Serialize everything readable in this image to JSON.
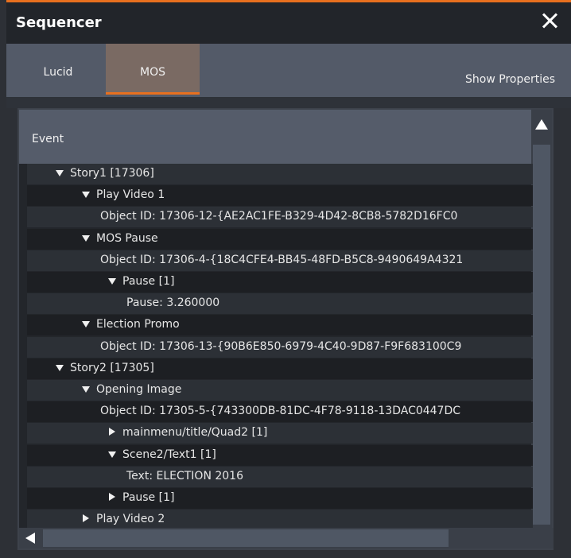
{
  "window": {
    "title": "Sequencer"
  },
  "tabs": [
    {
      "label": "Lucid",
      "active": false
    },
    {
      "label": "MOS",
      "active": true
    }
  ],
  "show_properties_label": "Show Properties",
  "column_header": "Event",
  "tree": [
    {
      "text": "Story1 [17306]",
      "expander": "down",
      "level": 0
    },
    {
      "text": "Play Video 1",
      "expander": "down",
      "level": 1
    },
    {
      "text": "Object ID: 17306-12-{AE2AC1FE-B329-4D42-8CB8-5782D16FC0",
      "expander": "none",
      "level": 2
    },
    {
      "text": "MOS Pause",
      "expander": "down",
      "level": 1
    },
    {
      "text": "Object ID: 17306-4-{18C4CFE4-BB45-48FD-B5C8-9490649A4321",
      "expander": "none",
      "level": 2
    },
    {
      "text": "Pause [1]",
      "expander": "down",
      "level": 2
    },
    {
      "text": "Pause: 3.260000",
      "expander": "none",
      "level": 3
    },
    {
      "text": "Election Promo",
      "expander": "down",
      "level": 1
    },
    {
      "text": "Object ID: 17306-13-{90B6E850-6979-4C40-9D87-F9F683100C9",
      "expander": "none",
      "level": 2
    },
    {
      "text": "Story2 [17305]",
      "expander": "down",
      "level": 0
    },
    {
      "text": "Opening Image",
      "expander": "down",
      "level": 1
    },
    {
      "text": "Object ID: 17305-5-{743300DB-81DC-4F78-9118-13DAC0447DC",
      "expander": "none",
      "level": 2
    },
    {
      "text": "mainmenu/title/Quad2 [1]",
      "expander": "right",
      "level": 2
    },
    {
      "text": "Scene2/Text1 [1]",
      "expander": "down",
      "level": 2
    },
    {
      "text": "Text: ELECTION 2016",
      "expander": "none",
      "level": 3
    },
    {
      "text": "Pause [1]",
      "expander": "right",
      "level": 2
    },
    {
      "text": "Play Video 2",
      "expander": "right",
      "level": 1
    }
  ],
  "colors": {
    "accent": "#e8701f",
    "tab_active_bg": "#7a6a63"
  }
}
